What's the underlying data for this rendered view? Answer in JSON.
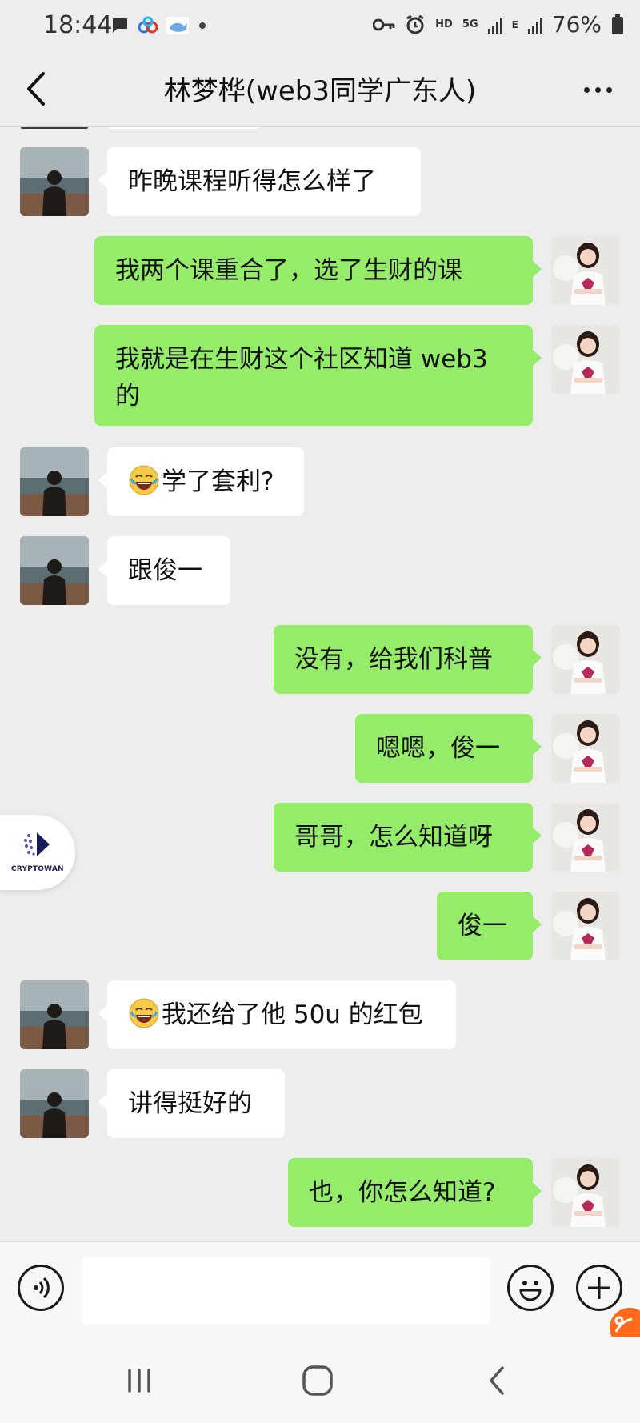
{
  "status_bar": {
    "time": "18:44",
    "battery_text": "76%",
    "network_label": "5G",
    "hd_label": "HD",
    "e_label": "E",
    "icons": [
      "message-icon",
      "baidu-cloud-icon",
      "whale-icon",
      "dot-icon",
      "key-icon",
      "alarm-icon",
      "signal-icon",
      "battery-icon"
    ]
  },
  "header": {
    "title": "林梦桦(web3同学广东人)",
    "back_icon": "chevron-left-icon",
    "more_icon": "more-dots-icon"
  },
  "messages": [
    {
      "dir": "in",
      "text": "昨晚课程听得怎么样了",
      "emoji": false
    },
    {
      "dir": "out",
      "text": "我两个课重合了，选了生财的课",
      "emoji": false
    },
    {
      "dir": "out",
      "text": "我就是在生财这个社区知道 web3 的",
      "emoji": false
    },
    {
      "dir": "in",
      "text": "学了套利?",
      "emoji": true
    },
    {
      "dir": "in",
      "text": "跟俊一",
      "emoji": false
    },
    {
      "dir": "out",
      "text": "没有，给我们科普",
      "emoji": false
    },
    {
      "dir": "out",
      "text": "嗯嗯，俊一",
      "emoji": false
    },
    {
      "dir": "out",
      "text": "哥哥，怎么知道呀",
      "emoji": false
    },
    {
      "dir": "out",
      "text": "俊一",
      "emoji": false
    },
    {
      "dir": "in",
      "text": "我还给了他 50u 的红包",
      "emoji": true
    },
    {
      "dir": "in",
      "text": "讲得挺好的",
      "emoji": false
    },
    {
      "dir": "out",
      "text": "也，你怎么知道?",
      "emoji": false
    }
  ],
  "floating_widget": {
    "label": "CRYPTOWAN",
    "icon": "cryptowan-logo-icon"
  },
  "input_bar": {
    "placeholder": "",
    "value": "",
    "icons": [
      "voice-icon",
      "emoji-icon",
      "plus-icon"
    ]
  },
  "nav_bar": {
    "icons": [
      "recent-apps-icon",
      "home-icon",
      "back-icon"
    ]
  },
  "colors": {
    "background": "#ededed",
    "outgoing_bubble": "#95ec69",
    "incoming_bubble": "#ffffff"
  }
}
